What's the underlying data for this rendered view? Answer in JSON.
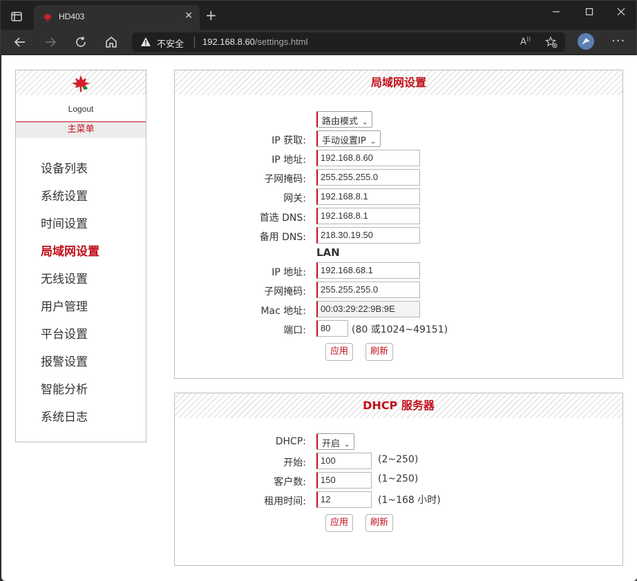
{
  "browser": {
    "tab_title": "HD403",
    "insecure_label": "不安全",
    "url_host": "192.168.8.60",
    "url_path": "/settings.html"
  },
  "sidebar": {
    "logout": "Logout",
    "main_menu": "主菜单",
    "items": [
      {
        "label": "设备列表",
        "active": false
      },
      {
        "label": "系统设置",
        "active": false
      },
      {
        "label": "时间设置",
        "active": false
      },
      {
        "label": "局域网设置",
        "active": true
      },
      {
        "label": "无线设置",
        "active": false
      },
      {
        "label": "用户管理",
        "active": false
      },
      {
        "label": "平台设置",
        "active": false
      },
      {
        "label": "报警设置",
        "active": false
      },
      {
        "label": "智能分析",
        "active": false
      },
      {
        "label": "系统日志",
        "active": false
      }
    ]
  },
  "lan": {
    "title": "局域网设置",
    "mode_select": "路由模式",
    "ip_get_label": "IP 获取:",
    "ip_get_select": "手动设置IP",
    "wan_ip_label": "IP 地址:",
    "wan_ip": "192.168.8.60",
    "wan_mask_label": "子网掩码:",
    "wan_mask": "255.255.255.0",
    "gateway_label": "网关:",
    "gateway": "192.168.8.1",
    "dns1_label": "首选 DNS:",
    "dns1": "192.168.8.1",
    "dns2_label": "备用 DNS:",
    "dns2": "218.30.19.50",
    "lan_heading": "LAN",
    "lan_ip_label": "IP 地址:",
    "lan_ip": "192.168.68.1",
    "lan_mask_label": "子网掩码:",
    "lan_mask": "255.255.255.0",
    "mac_label": "Mac 地址:",
    "mac": "00:03:29:22:9B:9E",
    "port_label": "端口:",
    "port": "80",
    "port_hint": "(80 或1024~49151)",
    "apply": "应用",
    "refresh": "刷新"
  },
  "dhcp": {
    "title": "DHCP 服务器",
    "dhcp_label": "DHCP:",
    "dhcp_select": "开启",
    "start_label": "开始:",
    "start": "100",
    "start_hint": "(2~250)",
    "clients_label": "客户数:",
    "clients": "150",
    "clients_hint": "(1~250)",
    "lease_label": "租用时间:",
    "lease": "12",
    "lease_hint": "(1~168 小时)",
    "apply": "应用",
    "refresh": "刷新"
  },
  "colors": {
    "accent": "#c0101a",
    "browser_chrome": "#202020"
  }
}
